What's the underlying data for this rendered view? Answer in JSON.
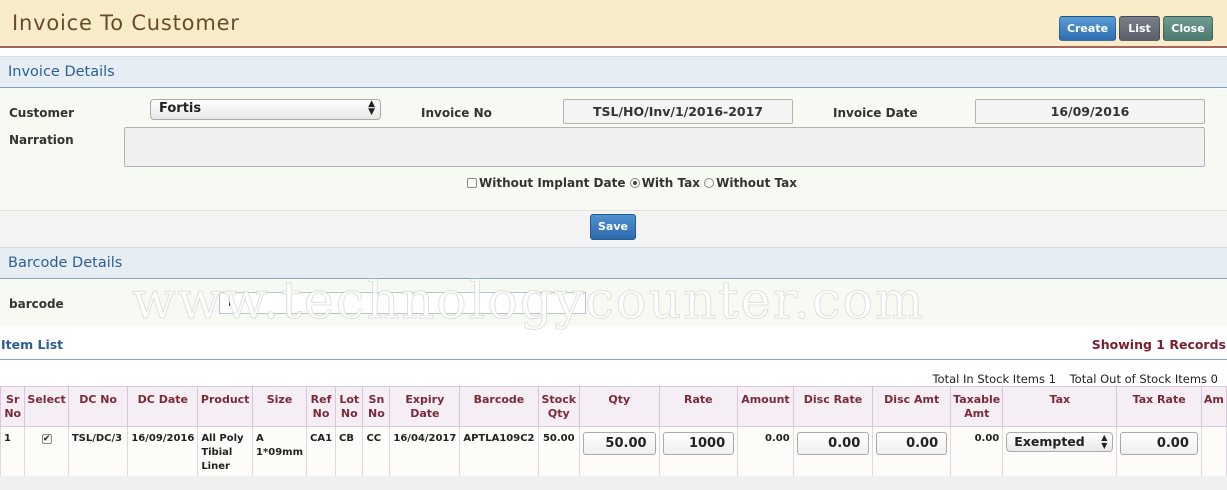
{
  "header": {
    "title": "Invoice To Customer",
    "buttons": {
      "create": "Create",
      "list": "List",
      "close": "Close"
    }
  },
  "invoice_details": {
    "section_title": "Invoice Details",
    "customer_label": "Customer",
    "customer_value": "Fortis",
    "invoice_no_label": "Invoice No",
    "invoice_no_value": "TSL/HO/Inv/1/2016-2017",
    "invoice_date_label": "Invoice Date",
    "invoice_date_value": "16/09/2016",
    "narration_label": "Narration",
    "narration_value": "",
    "options": {
      "without_implant_date": "Without Implant Date",
      "with_tax": "With Tax",
      "without_tax": "Without Tax",
      "selected": "With Tax"
    },
    "save_label": "Save"
  },
  "barcode_details": {
    "section_title": "Barcode Details",
    "barcode_label": "barcode",
    "barcode_value": "",
    "watermark": "www.technologycounter.com"
  },
  "item_list": {
    "title": "Item List",
    "records": "Showing 1 Records",
    "total_in_stock": "Total In Stock Items 1",
    "total_out_of_stock": "Total Out of Stock Items 0",
    "columns": {
      "sr_no": "Sr No",
      "select": "Select",
      "dc_no": "DC No",
      "dc_date": "DC Date",
      "product": "Product",
      "size": "Size",
      "ref_no": "Ref No",
      "lot_no": "Lot No",
      "sn_no": "Sn No",
      "expiry_date": "Expiry Date",
      "barcode": "Barcode",
      "stock_qty": "Stock Qty",
      "qty": "Qty",
      "rate": "Rate",
      "amount": "Amount",
      "disc_rate": "Disc Rate",
      "disc_amt": "Disc Amt",
      "taxable_amt": "Taxable Amt",
      "tax": "Tax",
      "tax_rate": "Tax Rate",
      "am": "Am"
    },
    "rows": [
      {
        "sr_no": "1",
        "selected": true,
        "dc_no": "TSL/DC/3",
        "dc_date": "16/09/2016",
        "product": "All Poly Tibial Liner",
        "size": "A 1*09mm",
        "ref_no": "CA1",
        "lot_no": "CB",
        "sn_no": "CC",
        "expiry_date": "16/04/2017",
        "barcode": "APTLA109C2",
        "stock_qty": "50.00",
        "qty": "50.00",
        "rate": "1000",
        "amount": "0.00",
        "disc_rate": "0.00",
        "disc_amt": "0.00",
        "taxable_amt": "0.00",
        "tax": "Exempted",
        "tax_rate": "0.00"
      }
    ]
  }
}
